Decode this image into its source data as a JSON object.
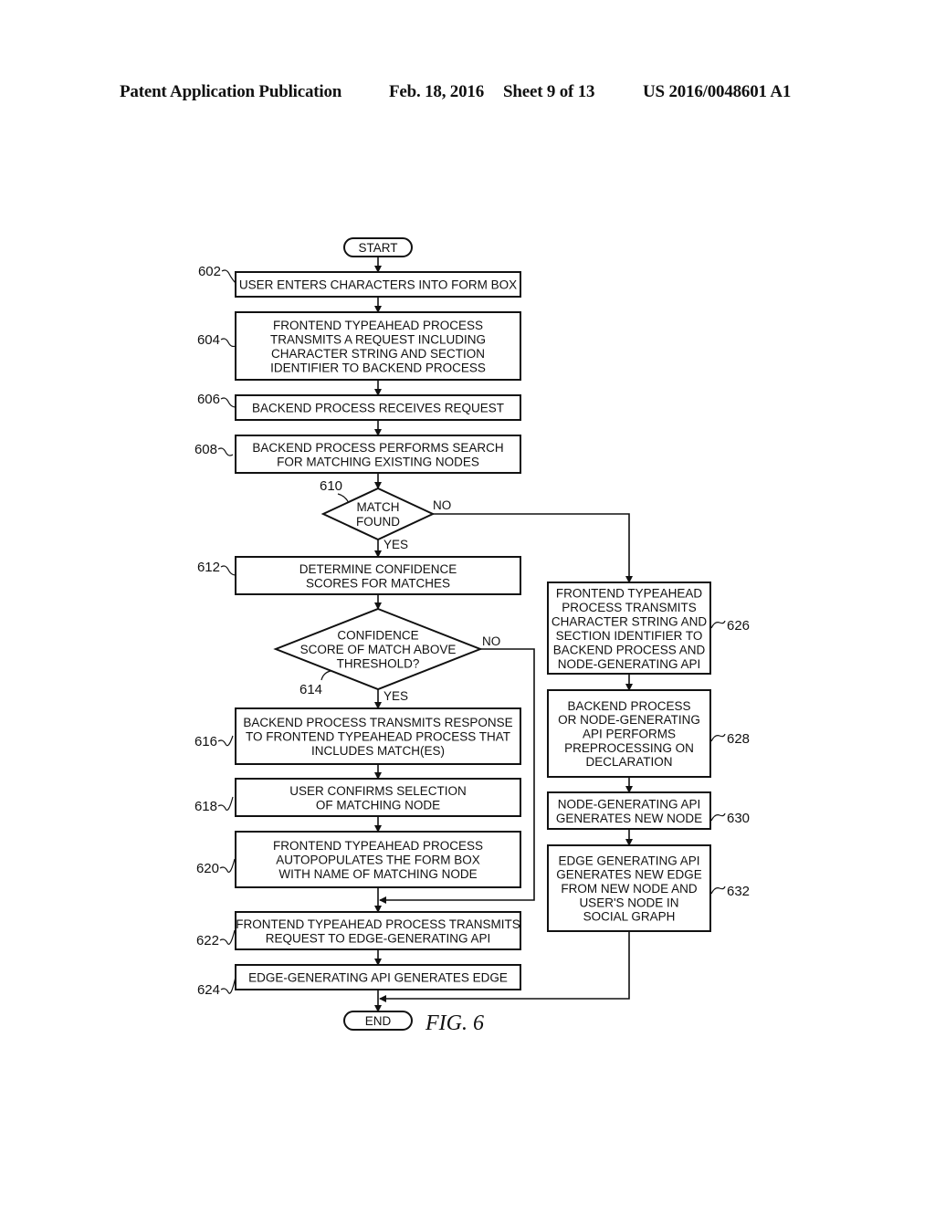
{
  "header": {
    "publication": "Patent Application Publication",
    "date": "Feb. 18, 2016",
    "sheet": "Sheet 9 of 13",
    "number": "US 2016/0048601 A1"
  },
  "figure_label": "FIG. 6",
  "terminals": {
    "start": "START",
    "end": "END"
  },
  "steps": {
    "s602": {
      "ref": "602",
      "lines": [
        "USER ENTERS CHARACTERS INTO FORM BOX"
      ]
    },
    "s604": {
      "ref": "604",
      "lines": [
        "FRONTEND TYPEAHEAD PROCESS",
        "TRANSMITS A REQUEST INCLUDING",
        "CHARACTER STRING AND SECTION",
        "IDENTIFIER TO BACKEND PROCESS"
      ]
    },
    "s606": {
      "ref": "606",
      "lines": [
        "BACKEND PROCESS RECEIVES REQUEST"
      ]
    },
    "s608": {
      "ref": "608",
      "lines": [
        "BACKEND PROCESS PERFORMS SEARCH",
        "FOR MATCHING EXISTING NODES"
      ]
    },
    "d610": {
      "ref": "610",
      "lines": [
        "MATCH",
        "FOUND"
      ],
      "yes": "YES",
      "no": "NO"
    },
    "s612": {
      "ref": "612",
      "lines": [
        "DETERMINE CONFIDENCE",
        "SCORES FOR MATCHES"
      ]
    },
    "d614": {
      "ref": "614",
      "lines": [
        "CONFIDENCE",
        "SCORE OF MATCH ABOVE",
        "THRESHOLD?"
      ],
      "yes": "YES",
      "no": "NO"
    },
    "s616": {
      "ref": "616",
      "lines": [
        "BACKEND PROCESS TRANSMITS RESPONSE",
        "TO FRONTEND TYPEAHEAD PROCESS THAT",
        "INCLUDES MATCH(ES)"
      ]
    },
    "s618": {
      "ref": "618",
      "lines": [
        "USER CONFIRMS SELECTION",
        "OF MATCHING NODE"
      ]
    },
    "s620": {
      "ref": "620",
      "lines": [
        "FRONTEND TYPEAHEAD PROCESS",
        "AUTOPOPULATES THE FORM BOX",
        "WITH NAME OF MATCHING NODE"
      ]
    },
    "s622": {
      "ref": "622",
      "lines": [
        "FRONTEND TYPEAHEAD PROCESS TRANSMITS",
        "REQUEST TO EDGE-GENERATING API"
      ]
    },
    "s624": {
      "ref": "624",
      "lines": [
        "EDGE-GENERATING API GENERATES EDGE"
      ]
    },
    "s626": {
      "ref": "626",
      "lines": [
        "FRONTEND TYPEAHEAD",
        "PROCESS TRANSMITS",
        "CHARACTER STRING AND",
        "SECTION IDENTIFIER TO",
        "BACKEND PROCESS AND",
        "NODE-GENERATING API"
      ]
    },
    "s628": {
      "ref": "628",
      "lines": [
        "BACKEND PROCESS",
        "OR NODE-GENERATING",
        "API PERFORMS",
        "PREPROCESSING ON",
        "DECLARATION"
      ]
    },
    "s630": {
      "ref": "630",
      "lines": [
        "NODE-GENERATING API",
        "GENERATES NEW NODE"
      ]
    },
    "s632": {
      "ref": "632",
      "lines": [
        "EDGE GENERATING API",
        "GENERATES NEW EDGE",
        "FROM NEW NODE AND",
        "USER'S NODE IN",
        "SOCIAL GRAPH"
      ]
    }
  }
}
